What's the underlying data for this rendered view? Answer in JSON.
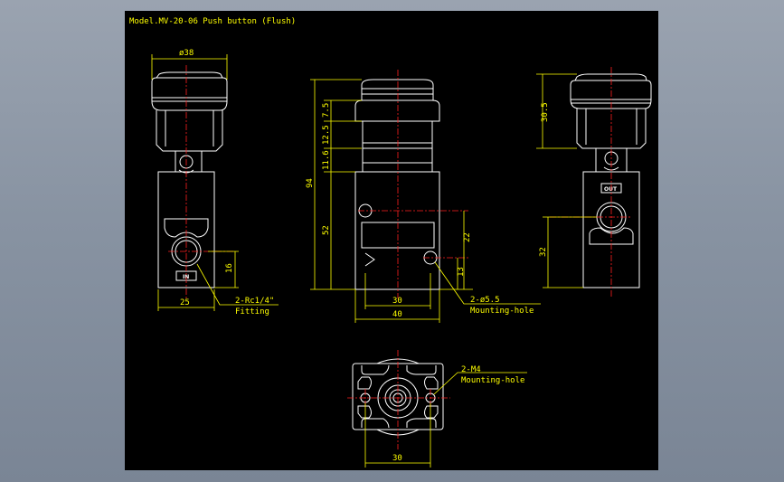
{
  "title": "Model.MV-20-06 Push button (Flush)",
  "colors": {
    "background": "#000000",
    "outline": "#ffffff",
    "dimension": "#ffff00",
    "centerline": "#ff2020",
    "frame": "#8893a2"
  },
  "dims": {
    "dia38": "ø38",
    "d25": "25",
    "d16": "16",
    "d30_front": "30",
    "d40": "40",
    "d94": "94",
    "d52": "52",
    "d7_5": "7.5",
    "d12_5": "12.5",
    "d11_6": "11.6",
    "d22": "22",
    "d13": "13",
    "d30_5": "30.5",
    "d32": "32",
    "d30_bottom": "30"
  },
  "callouts": {
    "fitting_line1": "2-Rc1/4\"",
    "fitting_line2": "Fitting",
    "mount_front_line1": "2-ø5.5",
    "mount_front_line2": "Mounting-hole",
    "mount_bottom_line1": "2-M4",
    "mount_bottom_line2": "Mounting-hole"
  },
  "port_labels": {
    "in": "IN",
    "out": "OUT"
  }
}
